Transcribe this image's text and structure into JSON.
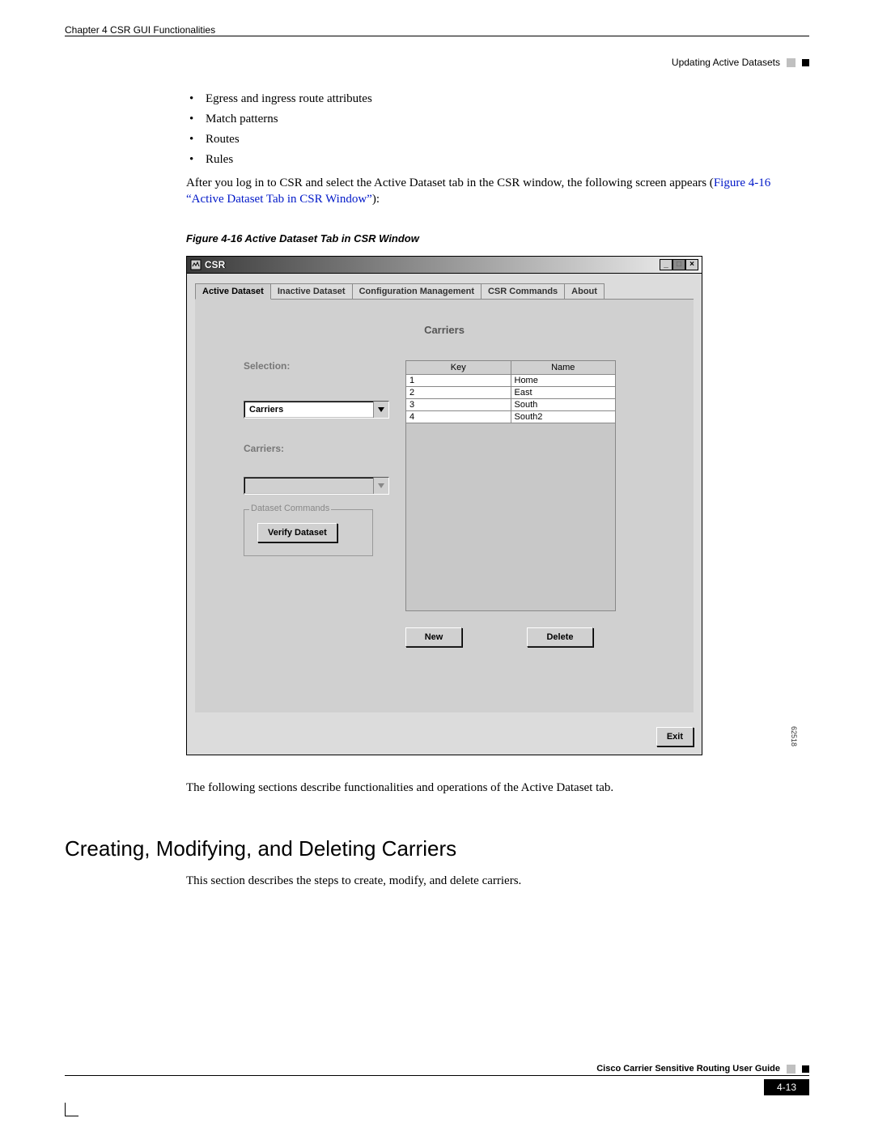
{
  "header": {
    "chapter_label": "Chapter 4    CSR GUI Functionalities",
    "section_label": "Updating Active Datasets"
  },
  "bullets": [
    "Egress and ingress route attributes",
    "Match patterns",
    "Routes",
    "Rules"
  ],
  "para1_pre": "After you log in to CSR and select the Active Dataset tab in the CSR window, the following screen appears (",
  "para1_link": "Figure 4-16 “Active Dataset Tab in CSR Window”",
  "para1_post": "):",
  "fig_caption": "Figure 4-16   Active Dataset Tab in CSR Window",
  "csr": {
    "title": "CSR",
    "tabs": [
      "Active Dataset",
      "Inactive Dataset",
      "Configuration Management",
      "CSR Commands",
      "About"
    ],
    "heading": "Carriers",
    "selection_label": "Selection:",
    "selection_value": "Carriers",
    "carriers_label": "Carriers:",
    "carriers_value": "",
    "dataset_cmds_legend": "Dataset Commands",
    "verify_btn": "Verify Dataset",
    "table": {
      "headers": [
        "Key",
        "Name"
      ],
      "rows": [
        {
          "key": "1",
          "name": "Home"
        },
        {
          "key": "2",
          "name": "East"
        },
        {
          "key": "3",
          "name": "South"
        },
        {
          "key": "4",
          "name": "South2"
        }
      ]
    },
    "new_btn": "New",
    "delete_btn": "Delete",
    "exit_btn": "Exit",
    "fig_num": "62518"
  },
  "para2": "The following sections describe functionalities and operations of the Active Dataset tab.",
  "h2": "Creating, Modifying, and Deleting Carriers",
  "para3": "This section describes the steps to create, modify, and delete carriers.",
  "footer": {
    "doc_title": "Cisco Carrier Sensitive Routing User Guide",
    "page_num": "4-13"
  }
}
